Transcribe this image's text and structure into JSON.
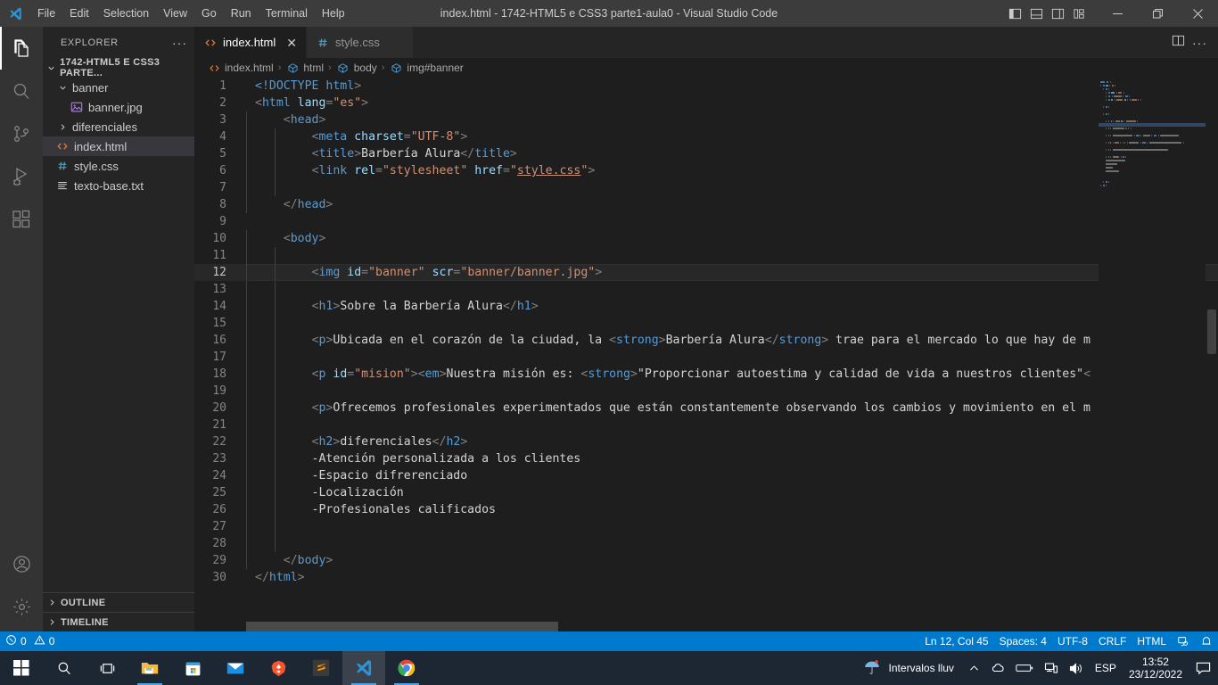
{
  "titlebar": {
    "logo_icon": "vscode-logo-icon",
    "menus": [
      "File",
      "Edit",
      "Selection",
      "View",
      "Go",
      "Run",
      "Terminal",
      "Help"
    ],
    "window_title": "index.html - 1742-HTML5 e CSS3 parte1-aula0 - Visual Studio Code",
    "layout_icons": [
      "toggle-primary-sidebar-icon",
      "toggle-panel-icon",
      "toggle-secondary-sidebar-icon",
      "customize-layout-icon"
    ],
    "window_controls": [
      "minimize-icon",
      "restore-icon",
      "close-icon"
    ]
  },
  "activitybar": {
    "items": [
      {
        "name": "explorer",
        "icon": "files-icon",
        "active": true
      },
      {
        "name": "search",
        "icon": "search-icon",
        "active": false
      },
      {
        "name": "source-control",
        "icon": "source-control-icon",
        "active": false
      },
      {
        "name": "run-and-debug",
        "icon": "debug-icon",
        "active": false
      },
      {
        "name": "extensions",
        "icon": "extensions-icon",
        "active": false
      }
    ],
    "bottom": [
      {
        "name": "accounts",
        "icon": "account-icon"
      },
      {
        "name": "manage",
        "icon": "gear-icon"
      }
    ]
  },
  "sidebar": {
    "header_title": "EXPLORER",
    "more_actions": "···",
    "root_folder": "1742-HTML5 E CSS3 PARTE...",
    "tree": [
      {
        "label": "banner",
        "type": "folder",
        "expanded": true,
        "depth": 1,
        "icon": "chevron-down-icon",
        "selected": false
      },
      {
        "label": "banner.jpg",
        "type": "image",
        "expanded": null,
        "depth": 2,
        "icon": "image-file-icon",
        "selected": false
      },
      {
        "label": "diferenciales",
        "type": "folder",
        "expanded": false,
        "depth": 1,
        "icon": "chevron-right-icon",
        "selected": false
      },
      {
        "label": "index.html",
        "type": "html",
        "expanded": null,
        "depth": 1,
        "icon": "html-file-icon",
        "selected": true
      },
      {
        "label": "style.css",
        "type": "css",
        "expanded": null,
        "depth": 1,
        "icon": "css-file-icon",
        "selected": false
      },
      {
        "label": "texto-base.txt",
        "type": "text",
        "expanded": null,
        "depth": 1,
        "icon": "text-file-icon",
        "selected": false
      }
    ],
    "bottom_sections": [
      "OUTLINE",
      "TIMELINE"
    ]
  },
  "editor": {
    "tabs": [
      {
        "label": "index.html",
        "icon": "html-file-icon",
        "active": true,
        "closable": true
      },
      {
        "label": "style.css",
        "icon": "css-file-icon",
        "active": false,
        "closable": false
      }
    ],
    "tab_actions": [
      "split-editor-icon",
      "more-actions-icon"
    ],
    "breadcrumbs": [
      {
        "label": "index.html",
        "icon": "html-file-icon"
      },
      {
        "label": "html",
        "icon": "symbol-field-icon"
      },
      {
        "label": "body",
        "icon": "symbol-field-icon"
      },
      {
        "label": "img#banner",
        "icon": "symbol-field-icon"
      }
    ],
    "breadcrumb_separator": "›",
    "current_line": 12,
    "lines": [
      {
        "n": 1,
        "indent": 0,
        "tokens": [
          {
            "c": "doctype",
            "t": "<!DOCTYPE"
          },
          {
            "c": "txt",
            "t": " "
          },
          {
            "c": "tag",
            "t": "html"
          },
          {
            "c": "brack",
            "t": ">"
          }
        ]
      },
      {
        "n": 2,
        "indent": 0,
        "tokens": [
          {
            "c": "brack",
            "t": "<"
          },
          {
            "c": "tag",
            "t": "html"
          },
          {
            "c": "txt",
            "t": " "
          },
          {
            "c": "attr",
            "t": "lang"
          },
          {
            "c": "brack",
            "t": "="
          },
          {
            "c": "str",
            "t": "\"es\""
          },
          {
            "c": "brack",
            "t": ">"
          }
        ]
      },
      {
        "n": 3,
        "indent": 1,
        "tokens": [
          {
            "c": "txt",
            "t": "    "
          },
          {
            "c": "brack",
            "t": "<"
          },
          {
            "c": "tag",
            "t": "head"
          },
          {
            "c": "brack",
            "t": ">"
          }
        ]
      },
      {
        "n": 4,
        "indent": 2,
        "tokens": [
          {
            "c": "txt",
            "t": "        "
          },
          {
            "c": "brack",
            "t": "<"
          },
          {
            "c": "tag",
            "t": "meta"
          },
          {
            "c": "txt",
            "t": " "
          },
          {
            "c": "attr",
            "t": "charset"
          },
          {
            "c": "brack",
            "t": "="
          },
          {
            "c": "str",
            "t": "\"UTF-8\""
          },
          {
            "c": "brack",
            "t": ">"
          }
        ]
      },
      {
        "n": 5,
        "indent": 2,
        "tokens": [
          {
            "c": "txt",
            "t": "        "
          },
          {
            "c": "brack",
            "t": "<"
          },
          {
            "c": "tag",
            "t": "title"
          },
          {
            "c": "brack",
            "t": ">"
          },
          {
            "c": "txt",
            "t": "Barbería Alura"
          },
          {
            "c": "brack",
            "t": "</"
          },
          {
            "c": "tag",
            "t": "title"
          },
          {
            "c": "brack",
            "t": ">"
          }
        ]
      },
      {
        "n": 6,
        "indent": 2,
        "tokens": [
          {
            "c": "txt",
            "t": "        "
          },
          {
            "c": "brack",
            "t": "<"
          },
          {
            "c": "tag",
            "t": "link"
          },
          {
            "c": "txt",
            "t": " "
          },
          {
            "c": "attr",
            "t": "rel"
          },
          {
            "c": "brack",
            "t": "="
          },
          {
            "c": "str",
            "t": "\"stylesheet\""
          },
          {
            "c": "txt",
            "t": " "
          },
          {
            "c": "attr",
            "t": "href"
          },
          {
            "c": "brack",
            "t": "="
          },
          {
            "c": "str",
            "t": "\""
          },
          {
            "c": "link",
            "t": "style.css"
          },
          {
            "c": "str",
            "t": "\""
          },
          {
            "c": "brack",
            "t": ">"
          }
        ]
      },
      {
        "n": 7,
        "indent": 2,
        "tokens": []
      },
      {
        "n": 8,
        "indent": 1,
        "tokens": [
          {
            "c": "txt",
            "t": "    "
          },
          {
            "c": "brack",
            "t": "</"
          },
          {
            "c": "tag",
            "t": "head"
          },
          {
            "c": "brack",
            "t": ">"
          }
        ]
      },
      {
        "n": 9,
        "indent": 0,
        "tokens": []
      },
      {
        "n": 10,
        "indent": 1,
        "tokens": [
          {
            "c": "txt",
            "t": "    "
          },
          {
            "c": "brack",
            "t": "<"
          },
          {
            "c": "tag",
            "t": "body"
          },
          {
            "c": "brack",
            "t": ">"
          }
        ]
      },
      {
        "n": 11,
        "indent": 2,
        "tokens": []
      },
      {
        "n": 12,
        "indent": 2,
        "tokens": [
          {
            "c": "txt",
            "t": "        "
          },
          {
            "c": "brack",
            "t": "<"
          },
          {
            "c": "tag",
            "t": "img"
          },
          {
            "c": "txt",
            "t": " "
          },
          {
            "c": "attr",
            "t": "id"
          },
          {
            "c": "brack",
            "t": "="
          },
          {
            "c": "str",
            "t": "\"banner\""
          },
          {
            "c": "txt",
            "t": " "
          },
          {
            "c": "attr",
            "t": "scr"
          },
          {
            "c": "brack",
            "t": "="
          },
          {
            "c": "str",
            "t": "\"banner/banner.jpg\""
          },
          {
            "c": "brack",
            "t": ">"
          }
        ]
      },
      {
        "n": 13,
        "indent": 2,
        "tokens": []
      },
      {
        "n": 14,
        "indent": 2,
        "tokens": [
          {
            "c": "txt",
            "t": "        "
          },
          {
            "c": "brack",
            "t": "<"
          },
          {
            "c": "tag",
            "t": "h1"
          },
          {
            "c": "brack",
            "t": ">"
          },
          {
            "c": "txt",
            "t": "Sobre la Barbería Alura"
          },
          {
            "c": "brack",
            "t": "</"
          },
          {
            "c": "tag",
            "t": "h1"
          },
          {
            "c": "brack",
            "t": ">"
          }
        ]
      },
      {
        "n": 15,
        "indent": 2,
        "tokens": []
      },
      {
        "n": 16,
        "indent": 2,
        "tokens": [
          {
            "c": "txt",
            "t": "        "
          },
          {
            "c": "brack",
            "t": "<"
          },
          {
            "c": "tag",
            "t": "p"
          },
          {
            "c": "brack",
            "t": ">"
          },
          {
            "c": "txt",
            "t": "Ubicada en el corazón de la ciudad, la "
          },
          {
            "c": "brack",
            "t": "<"
          },
          {
            "c": "tag",
            "t": "strong"
          },
          {
            "c": "brack",
            "t": ">"
          },
          {
            "c": "txt",
            "t": "Barbería Alura"
          },
          {
            "c": "brack",
            "t": "</"
          },
          {
            "c": "tag",
            "t": "strong"
          },
          {
            "c": "brack",
            "t": ">"
          },
          {
            "c": "txt",
            "t": " trae para el mercado lo que hay de m"
          }
        ]
      },
      {
        "n": 17,
        "indent": 2,
        "tokens": []
      },
      {
        "n": 18,
        "indent": 2,
        "tokens": [
          {
            "c": "txt",
            "t": "        "
          },
          {
            "c": "brack",
            "t": "<"
          },
          {
            "c": "tag",
            "t": "p"
          },
          {
            "c": "txt",
            "t": " "
          },
          {
            "c": "attr",
            "t": "id"
          },
          {
            "c": "brack",
            "t": "="
          },
          {
            "c": "str",
            "t": "\"mision\""
          },
          {
            "c": "brack",
            "t": ">"
          },
          {
            "c": "brack",
            "t": "<"
          },
          {
            "c": "tag",
            "t": "em"
          },
          {
            "c": "brack",
            "t": ">"
          },
          {
            "c": "txt",
            "t": "Nuestra misión es: "
          },
          {
            "c": "brack",
            "t": "<"
          },
          {
            "c": "tag",
            "t": "strong"
          },
          {
            "c": "brack",
            "t": ">"
          },
          {
            "c": "txt",
            "t": "\"Proporcionar autoestima y calidad de vida a nuestros clientes\""
          },
          {
            "c": "brack",
            "t": "<"
          }
        ]
      },
      {
        "n": 19,
        "indent": 2,
        "tokens": []
      },
      {
        "n": 20,
        "indent": 2,
        "tokens": [
          {
            "c": "txt",
            "t": "        "
          },
          {
            "c": "brack",
            "t": "<"
          },
          {
            "c": "tag",
            "t": "p"
          },
          {
            "c": "brack",
            "t": ">"
          },
          {
            "c": "txt",
            "t": "Ofrecemos profesionales experimentados que están constantemente observando los cambios y movimiento en el m"
          }
        ]
      },
      {
        "n": 21,
        "indent": 2,
        "tokens": []
      },
      {
        "n": 22,
        "indent": 2,
        "tokens": [
          {
            "c": "txt",
            "t": "        "
          },
          {
            "c": "brack",
            "t": "<"
          },
          {
            "c": "tag",
            "t": "h2"
          },
          {
            "c": "brack",
            "t": ">"
          },
          {
            "c": "txt",
            "t": "diferenciales"
          },
          {
            "c": "brack",
            "t": "</"
          },
          {
            "c": "tag",
            "t": "h2"
          },
          {
            "c": "brack",
            "t": ">"
          }
        ]
      },
      {
        "n": 23,
        "indent": 2,
        "tokens": [
          {
            "c": "txt",
            "t": "        -Atención personalizada a los clientes"
          }
        ]
      },
      {
        "n": 24,
        "indent": 2,
        "tokens": [
          {
            "c": "txt",
            "t": "        -Espacio difrerenciado"
          }
        ]
      },
      {
        "n": 25,
        "indent": 2,
        "tokens": [
          {
            "c": "txt",
            "t": "        -Localización"
          }
        ]
      },
      {
        "n": 26,
        "indent": 2,
        "tokens": [
          {
            "c": "txt",
            "t": "        -Profesionales calificados"
          }
        ]
      },
      {
        "n": 27,
        "indent": 2,
        "tokens": []
      },
      {
        "n": 28,
        "indent": 2,
        "tokens": []
      },
      {
        "n": 29,
        "indent": 1,
        "tokens": [
          {
            "c": "txt",
            "t": "    "
          },
          {
            "c": "brack",
            "t": "</"
          },
          {
            "c": "tag",
            "t": "body"
          },
          {
            "c": "brack",
            "t": ">"
          }
        ]
      },
      {
        "n": 30,
        "indent": 0,
        "tokens": [
          {
            "c": "brack",
            "t": "</"
          },
          {
            "c": "tag",
            "t": "html"
          },
          {
            "c": "brack",
            "t": ">"
          }
        ]
      }
    ]
  },
  "statusbar": {
    "left": [
      {
        "name": "problems",
        "icon": "error-icon",
        "errors": "0",
        "warn_icon": "warning-icon",
        "warnings": "0"
      }
    ],
    "right": [
      {
        "name": "cursor-position",
        "label": "Ln 12, Col 45"
      },
      {
        "name": "indentation",
        "label": "Spaces: 4"
      },
      {
        "name": "encoding",
        "label": "UTF-8"
      },
      {
        "name": "eol",
        "label": "CRLF"
      },
      {
        "name": "language-mode",
        "label": "HTML"
      }
    ],
    "right_icons": [
      "live-share-icon",
      "notifications-bell-icon"
    ],
    "accent_color": "#007acc"
  },
  "taskbar": {
    "buttons": [
      {
        "name": "start",
        "icon": "windows-logo-icon",
        "state": "idle"
      },
      {
        "name": "search",
        "icon": "search-icon",
        "state": "idle"
      },
      {
        "name": "task-view",
        "icon": "task-view-icon",
        "state": "idle"
      },
      {
        "name": "file-explorer",
        "icon": "folder-icon",
        "state": "running"
      },
      {
        "name": "microsoft-store",
        "icon": "store-icon",
        "state": "idle"
      },
      {
        "name": "mail",
        "icon": "mail-icon",
        "state": "idle"
      },
      {
        "name": "brave",
        "icon": "brave-icon",
        "state": "idle"
      },
      {
        "name": "sublime-text",
        "icon": "sublime-icon",
        "state": "idle"
      },
      {
        "name": "visual-studio-code",
        "icon": "vscode-icon",
        "state": "active"
      },
      {
        "name": "google-chrome",
        "icon": "chrome-icon",
        "state": "running"
      }
    ],
    "weather": {
      "icon": "rain-icon",
      "label": "Intervalos lluv"
    },
    "tray_icons": [
      "chevron-up-icon",
      "onedrive-icon",
      "battery-icon",
      "network-icon",
      "volume-icon"
    ],
    "language": "ESP",
    "time": "13:52",
    "date": "23/12/2022",
    "notification_icon": "notification-icon"
  }
}
